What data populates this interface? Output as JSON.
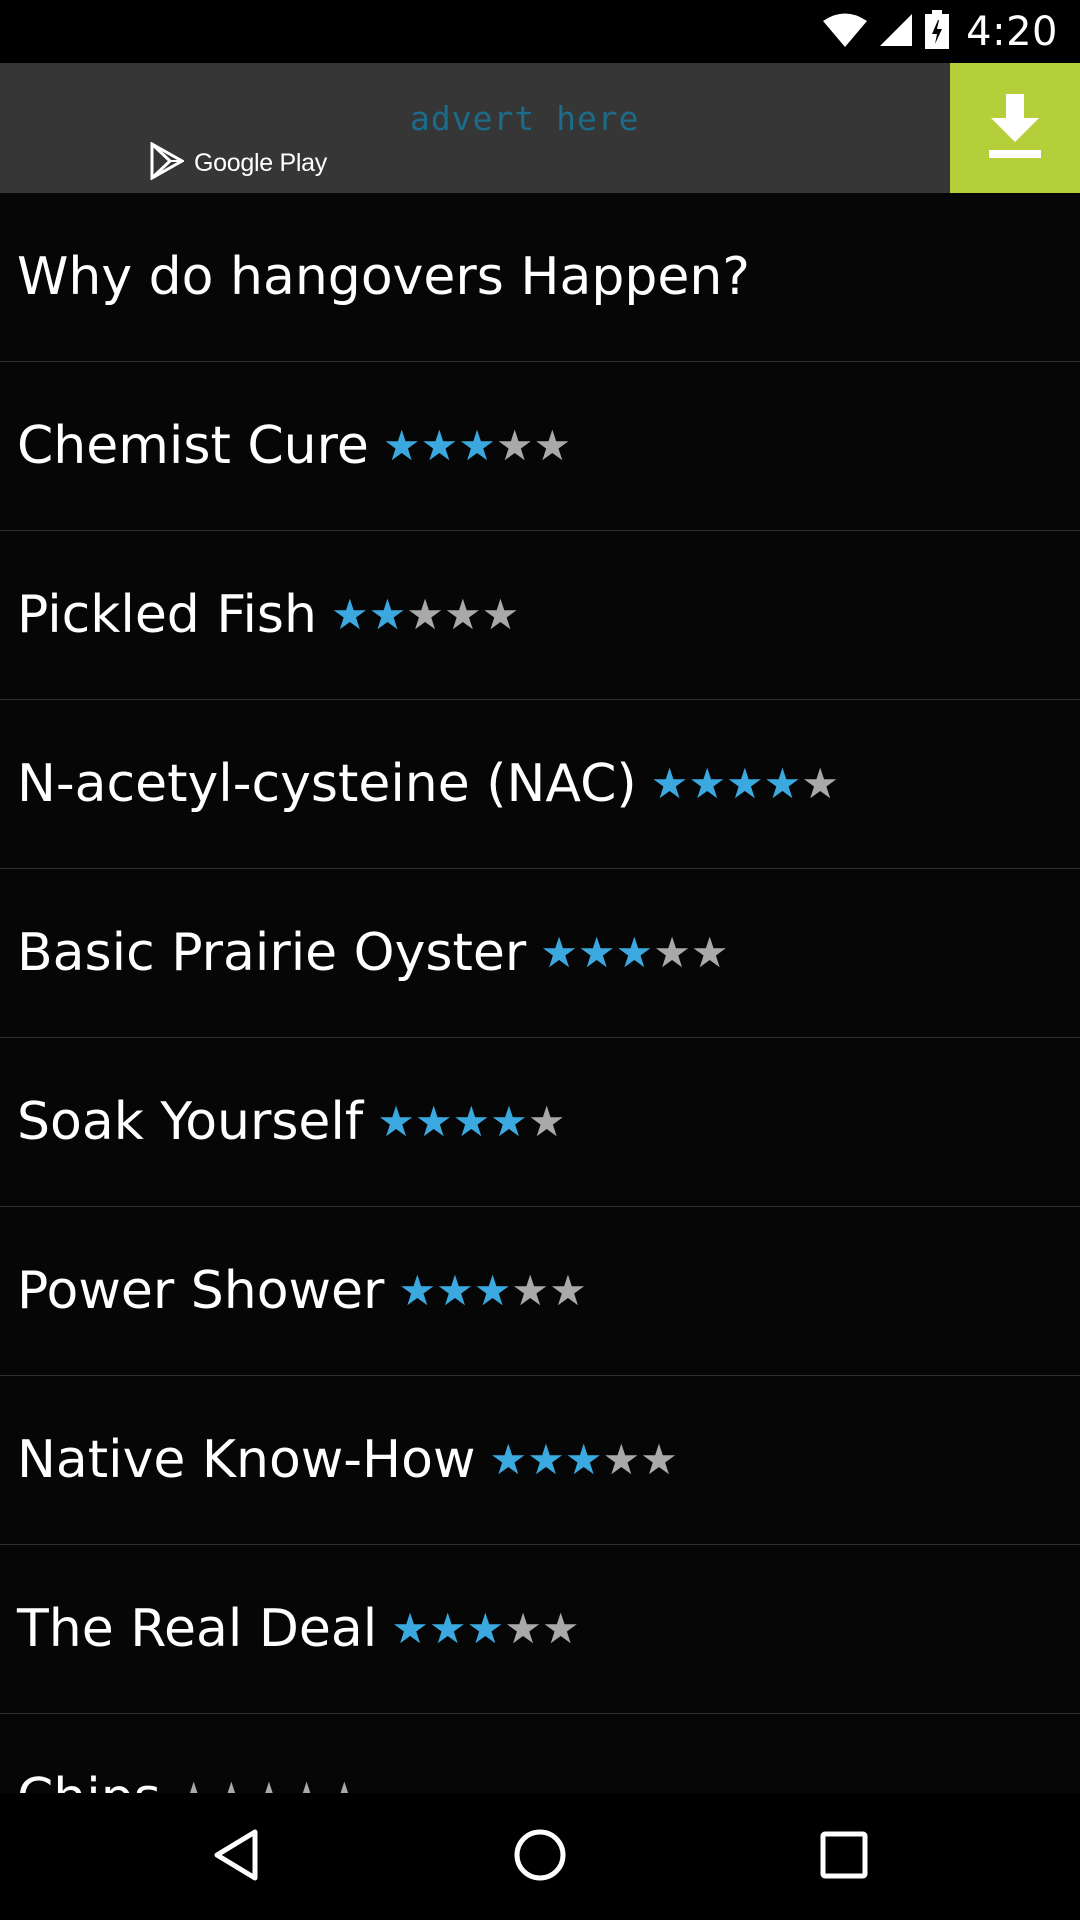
{
  "status_bar": {
    "time": "4:20",
    "icons": [
      "wifi-icon",
      "signal-icon",
      "battery-icon"
    ]
  },
  "ad": {
    "store_badge": "Google Play",
    "advert_text": "advert here",
    "download_icon": "download-icon",
    "colors": {
      "banner_bg": "#363636",
      "download_bg": "#b5cf3a",
      "advert_text": "#1c6b8a"
    }
  },
  "colors": {
    "star_on": "#3ba9e0",
    "star_off": "#a9a9a9"
  },
  "list": {
    "items": [
      {
        "title": "Why do hangovers Happen?",
        "rating": null
      },
      {
        "title": "Chemist Cure",
        "rating": 3
      },
      {
        "title": "Pickled Fish",
        "rating": 2
      },
      {
        "title": "N-acetyl-cysteine (NAC)",
        "rating": 4
      },
      {
        "title": "Basic Prairie Oyster",
        "rating": 3
      },
      {
        "title": "Soak Yourself",
        "rating": 4
      },
      {
        "title": "Power Shower",
        "rating": 3
      },
      {
        "title": "Native Know-How",
        "rating": 3
      },
      {
        "title": "The Real Deal",
        "rating": 3
      },
      {
        "title": "Chips",
        "rating": 0
      }
    ],
    "max_rating": 5
  },
  "nav_bar": {
    "icons": [
      "back-icon",
      "home-icon",
      "recents-icon"
    ]
  }
}
